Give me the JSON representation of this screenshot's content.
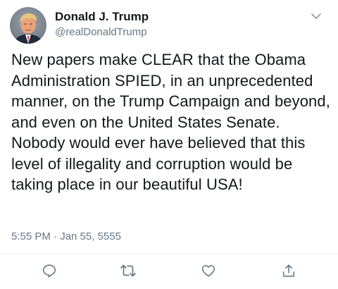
{
  "tweet": {
    "author_name": "Donald J. Trump",
    "author_handle": "@realDonaldTrump",
    "text": "New papers make CLEAR that the Obama Administration SPIED, in an unprecedented manner, on the Trump Campaign and beyond, and even on the United States Senate. Nobody would ever have believed that this level of illegality and corruption would be taking place in our beautiful USA!",
    "timestamp": "5:55 PM · Jan 55, 5555"
  },
  "icons": {
    "menu": "chevron-down-icon",
    "reply": "reply-icon",
    "retweet": "retweet-icon",
    "like": "heart-icon",
    "share": "share-icon"
  },
  "colors": {
    "text_primary": "#14171a",
    "text_secondary": "#657786",
    "icon": "#657786",
    "divider": "#e6ecf0"
  }
}
